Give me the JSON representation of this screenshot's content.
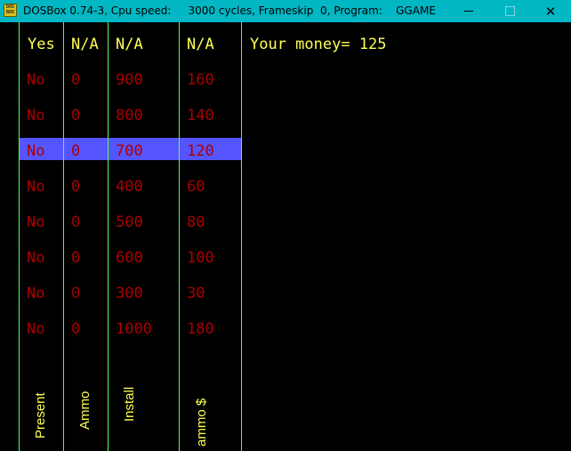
{
  "window": {
    "title": "DOSBox 0.74-3, Cpu speed:     3000 cycles, Frameskip  0, Program:    GGAME",
    "icon": "dosbox-icon",
    "icon_text": "DOS BOX",
    "minimize_icon": "minimize-icon",
    "maximize_icon": "maximize-icon",
    "close_icon": "close-icon",
    "titlebar_color": "#00b7c3"
  },
  "table": {
    "header": [
      "Yes",
      "N/A",
      "N/A",
      "N/A"
    ],
    "rows": [
      [
        "No",
        "0",
        "900",
        "160"
      ],
      [
        "No",
        "0",
        "800",
        "140"
      ],
      [
        "No",
        "0",
        "700",
        "120"
      ],
      [
        "No",
        "0",
        "400",
        "60"
      ],
      [
        "No",
        "0",
        "500",
        "80"
      ],
      [
        "No",
        "0",
        "600",
        "100"
      ],
      [
        "No",
        "0",
        "300",
        "30"
      ],
      [
        "No",
        "0",
        "1000",
        "180"
      ]
    ],
    "selected_row": 2,
    "column_labels": [
      "Present",
      "Ammo",
      "Install",
      "ammo $"
    ]
  },
  "money": {
    "text": "Your money= 125"
  },
  "colors": {
    "background": "#000000",
    "header_text": "#ffff55",
    "row_text": "#aa0000",
    "highlight": "#5555ff",
    "grid_lines": "#55ff55"
  }
}
